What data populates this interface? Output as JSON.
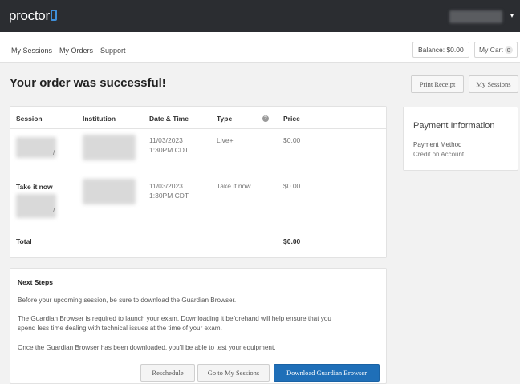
{
  "header": {
    "logo_text": "proctor",
    "account_caret": "▾"
  },
  "nav": {
    "items": [
      "My Sessions",
      "My Orders",
      "Support"
    ],
    "balance_label": "Balance: $0.00",
    "cart_label": "My Cart",
    "cart_count": "0"
  },
  "page": {
    "title": "Your order was successful!",
    "print_receipt_label": "Print Receipt",
    "my_sessions_label": "My Sessions"
  },
  "order_table": {
    "columns": [
      "Session",
      "Institution",
      "Date & Time",
      "Type",
      "Price"
    ],
    "info_icon": "?",
    "rows": [
      {
        "session": "",
        "session_suffix": "/",
        "date": "11/03/2023",
        "time": "1:30PM CDT",
        "type": "Live+",
        "price": "$0.00"
      },
      {
        "session": "Take it now",
        "session_suffix": "/",
        "date": "11/03/2023",
        "time": "1:30PM CDT",
        "type": "Take it now",
        "price": "$0.00"
      }
    ],
    "total_label": "Total",
    "total_value": "$0.00"
  },
  "payment": {
    "title": "Payment Information",
    "method_label": "Payment Method",
    "method_value": "Credit on Account"
  },
  "next_steps": {
    "title": "Next Steps",
    "paragraph_1": "Before your upcoming session, be sure to download the Guardian Browser.",
    "paragraph_2_line_1": "The Guardian Browser is required to launch your exam. Downloading it beforehand will help ensure that you",
    "paragraph_2_line_2": "spend less time dealing with technical issues at the time of your exam.",
    "paragraph_3": "Once the Guardian Browser has been downloaded, you'll be able to test your equipment.",
    "reschedule_label": "Reschedule",
    "go_to_sessions_label": "Go to My Sessions",
    "download_label": "Download Guardian Browser"
  },
  "colors": {
    "topbar": "#2b2d31",
    "accent": "#3f8fd9",
    "primary_button": "#1f6fb8"
  }
}
